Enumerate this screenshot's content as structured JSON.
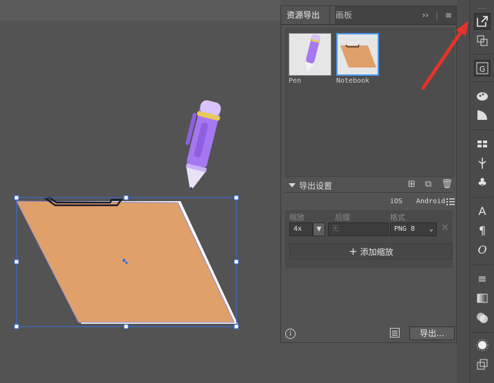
{
  "panel": {
    "tabs": [
      {
        "label": "资源导出",
        "active": true
      },
      {
        "label": "画板",
        "active": false
      }
    ],
    "tab_tools": {
      "expand": "››",
      "menu": "≡"
    },
    "assets": [
      {
        "label": "Pen",
        "selected": false
      },
      {
        "label": "Notebook",
        "selected": true
      }
    ],
    "export_settings": {
      "title": "导出设置",
      "platforms": [
        "iOS",
        "Android"
      ],
      "columns": {
        "scale": "缩放",
        "suffix": "后缀",
        "format": "格式"
      },
      "row": {
        "scale": "4x",
        "suffix_placeholder": "无",
        "format": "PNG 8"
      },
      "add_scale_label": "添加缩放"
    },
    "footer": {
      "export_label": "导出..."
    }
  },
  "colors": {
    "notebook_fill": "#E0A06A",
    "pen_purple": "#A577F0",
    "selection_blue": "#3B6FE0",
    "arrow_red": "#E6332A"
  },
  "toolbar": {
    "icons": [
      "export-icon",
      "artboards-icon",
      "libraries-icon",
      "color-guide-icon",
      "gradient-icon",
      "swatches-icon",
      "brushes-icon",
      "symbols-icon",
      "character-icon",
      "paragraph-icon",
      "opentype-icon",
      "stroke-icon",
      "gradient-panel-icon",
      "transparency-icon",
      "appearance-icon",
      "layers-icon"
    ]
  }
}
